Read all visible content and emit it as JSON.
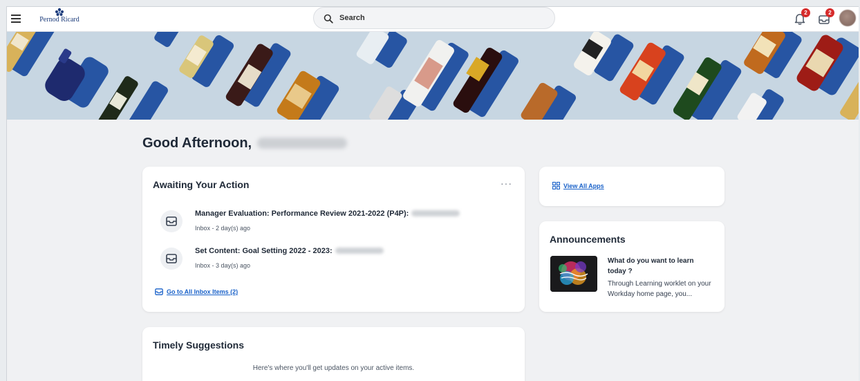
{
  "header": {
    "brand": "Pernod Ricard",
    "search_placeholder": "Search",
    "notifications_count": "2",
    "inbox_count": "2"
  },
  "greeting": {
    "text": "Good Afternoon,"
  },
  "awaiting": {
    "title": "Awaiting Your Action",
    "more": "···",
    "items": [
      {
        "title": "Manager Evaluation: Performance Review 2021-2022 (P4P):",
        "subtitle": "Inbox - 2 day(s) ago"
      },
      {
        "title": "Set Content: Goal Setting 2022 - 2023:",
        "subtitle": "Inbox - 3 day(s) ago"
      }
    ],
    "go_link": "Go to All Inbox Items (2)"
  },
  "apps": {
    "link": "View All Apps"
  },
  "announcements": {
    "title": "Announcements",
    "item_title": "What do you want to learn today ?",
    "item_body": "Through Learning worklet on your Workday home page, you..."
  },
  "timely": {
    "title": "Timely Suggestions",
    "text": "Here's where you'll get updates on your active items."
  },
  "colors": {
    "accent": "#1a62c9",
    "badge": "#d62b2b",
    "banner_bg": "#c7d6e2"
  }
}
